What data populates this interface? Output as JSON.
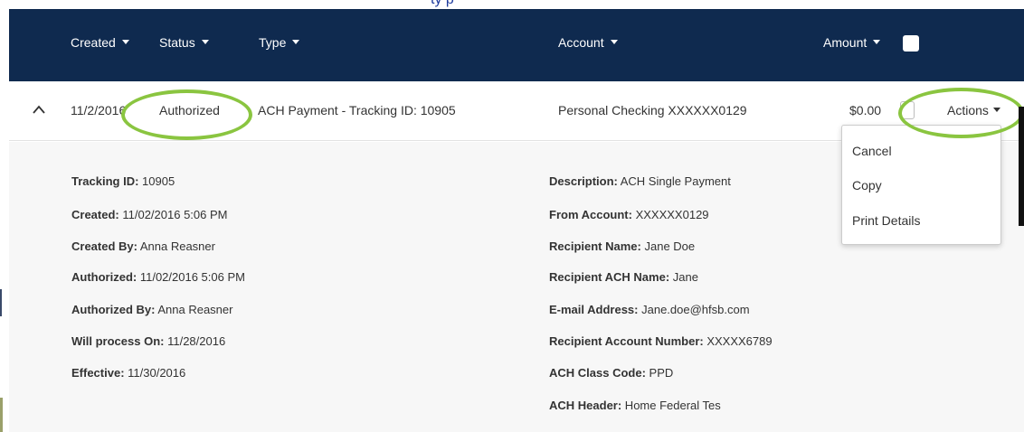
{
  "top_text": "ty p",
  "header": {
    "columns": [
      "Created",
      "Status",
      "Type",
      "Account",
      "Amount"
    ]
  },
  "row": {
    "created": "11/2/2016",
    "status": "Authorized",
    "type": "ACH Payment - Tracking ID: 10905",
    "account": "Personal Checking XXXXXX0129",
    "amount": "$0.00",
    "actions_label": "Actions"
  },
  "menu": {
    "items": [
      "Cancel",
      "Copy",
      "Print Details"
    ]
  },
  "details": {
    "left": [
      {
        "label": "Tracking ID:",
        "value": " 10905"
      },
      {
        "label": "Created:",
        "value": " 11/02/2016 5:06 PM"
      },
      {
        "label": "Created By:",
        "value": " Anna Reasner"
      },
      {
        "label": "Authorized:",
        "value": " 11/02/2016 5:06 PM"
      },
      {
        "label": "Authorized By:",
        "value": " Anna Reasner"
      },
      {
        "label": "Will process On:",
        "value": " 11/28/2016"
      },
      {
        "label": "Effective:",
        "value": " 11/30/2016"
      }
    ],
    "right": [
      {
        "label": "Description:",
        "value": " ACH Single Payment"
      },
      {
        "label": "From Account:",
        "value": " XXXXXX0129"
      },
      {
        "label": "Recipient Name:",
        "value": " Jane Doe"
      },
      {
        "label": "Recipient ACH Name:",
        "value": " Jane"
      },
      {
        "label": "E-mail Address:",
        "value": " Jane.doe@hfsb.com"
      },
      {
        "label": "Recipient Account Number:",
        "value": " XXXXX6789"
      },
      {
        "label": "ACH Class Code:",
        "value": " PPD"
      },
      {
        "label": "ACH Header:",
        "value": " Home Federal Tes"
      }
    ]
  },
  "colors": {
    "header_bg": "#0f2a4f",
    "highlight": "#8ac540",
    "detail_bg": "#f7f7f7"
  },
  "icons": {
    "expand": "chevron-up-icon",
    "sort": "caret-down-icon"
  }
}
